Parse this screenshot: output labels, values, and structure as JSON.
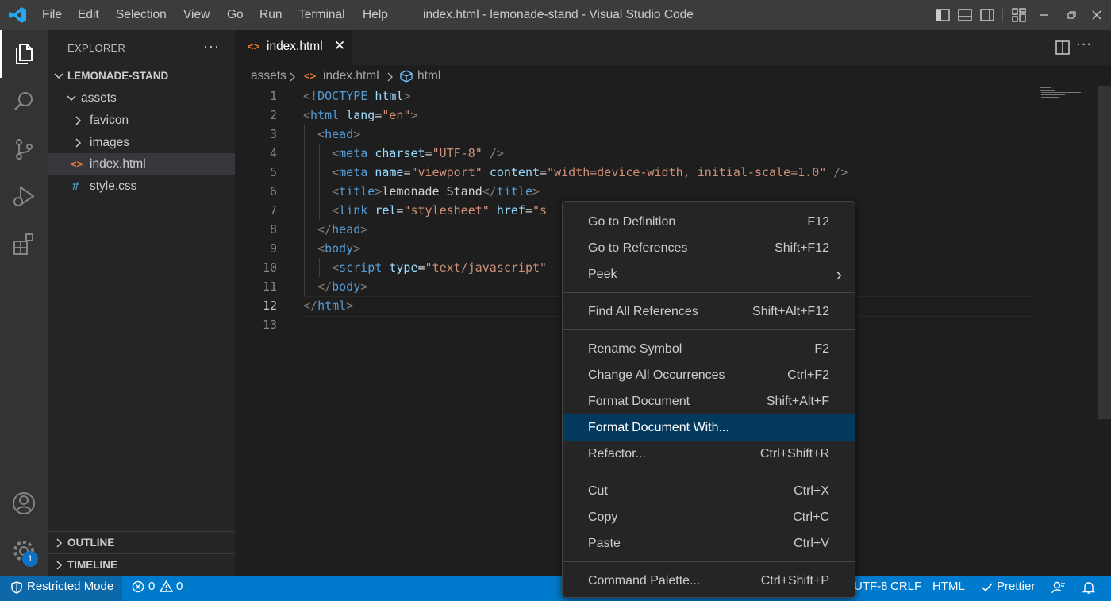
{
  "titlebar": {
    "menu": [
      "File",
      "Edit",
      "Selection",
      "View",
      "Go",
      "Run",
      "Terminal",
      "Help"
    ],
    "window_title": "index.html - lemonade-stand - Visual Studio Code"
  },
  "activity_bar": {
    "items": [
      "explorer-icon",
      "search-icon",
      "source-control-icon",
      "run-debug-icon",
      "extensions-icon"
    ],
    "bottom": [
      "accounts-icon",
      "manage-gear-icon"
    ],
    "settings_badge": "1"
  },
  "sidebar": {
    "title": "EXPLORER",
    "more": "···",
    "project": "LEMONADE-STAND",
    "folder": "assets",
    "subfolders": [
      "favicon",
      "images"
    ],
    "files": [
      {
        "name": "index.html",
        "icon": "<>"
      },
      {
        "name": "style.css",
        "icon": "#"
      }
    ],
    "outline": "OUTLINE",
    "timeline": "TIMELINE"
  },
  "tabs": [
    {
      "label": "index.html",
      "icon": "<>",
      "close": "✕"
    }
  ],
  "breadcrumb": {
    "items": [
      "assets",
      "index.html",
      "html"
    ]
  },
  "editor": {
    "line_numbers": [
      "1",
      "2",
      "3",
      "4",
      "5",
      "6",
      "7",
      "8",
      "9",
      "10",
      "11",
      "12",
      "13"
    ],
    "active_line": "12"
  },
  "context_menu": {
    "groups": [
      [
        {
          "label": "Go to Definition",
          "key": "F12"
        },
        {
          "label": "Go to References",
          "key": "Shift+F12"
        },
        {
          "label": "Peek",
          "key": "›"
        }
      ],
      [
        {
          "label": "Find All References",
          "key": "Shift+Alt+F12"
        }
      ],
      [
        {
          "label": "Rename Symbol",
          "key": "F2"
        },
        {
          "label": "Change All Occurrences",
          "key": "Ctrl+F2"
        },
        {
          "label": "Format Document",
          "key": "Shift+Alt+F"
        },
        {
          "label": "Format Document With...",
          "key": ""
        },
        {
          "label": "Refactor...",
          "key": "Ctrl+Shift+R"
        }
      ],
      [
        {
          "label": "Cut",
          "key": "Ctrl+X"
        },
        {
          "label": "Copy",
          "key": "Ctrl+C"
        },
        {
          "label": "Paste",
          "key": "Ctrl+V"
        }
      ],
      [
        {
          "label": "Command Palette...",
          "key": "Ctrl+Shift+P"
        }
      ]
    ],
    "highlighted": "Format Document With..."
  },
  "statusbar": {
    "restricted": "Restricted Mode",
    "errors": "0",
    "warnings": "0",
    "encoding": "UTF-8",
    "eol": "CRLF",
    "language": "HTML",
    "formatter": "Prettier"
  },
  "colors": {
    "statusbar": "#007acc",
    "activity_bar": "#333333",
    "sidebar": "#252526",
    "editor": "#1e1e1e",
    "menu_highlight": "#04395e"
  }
}
